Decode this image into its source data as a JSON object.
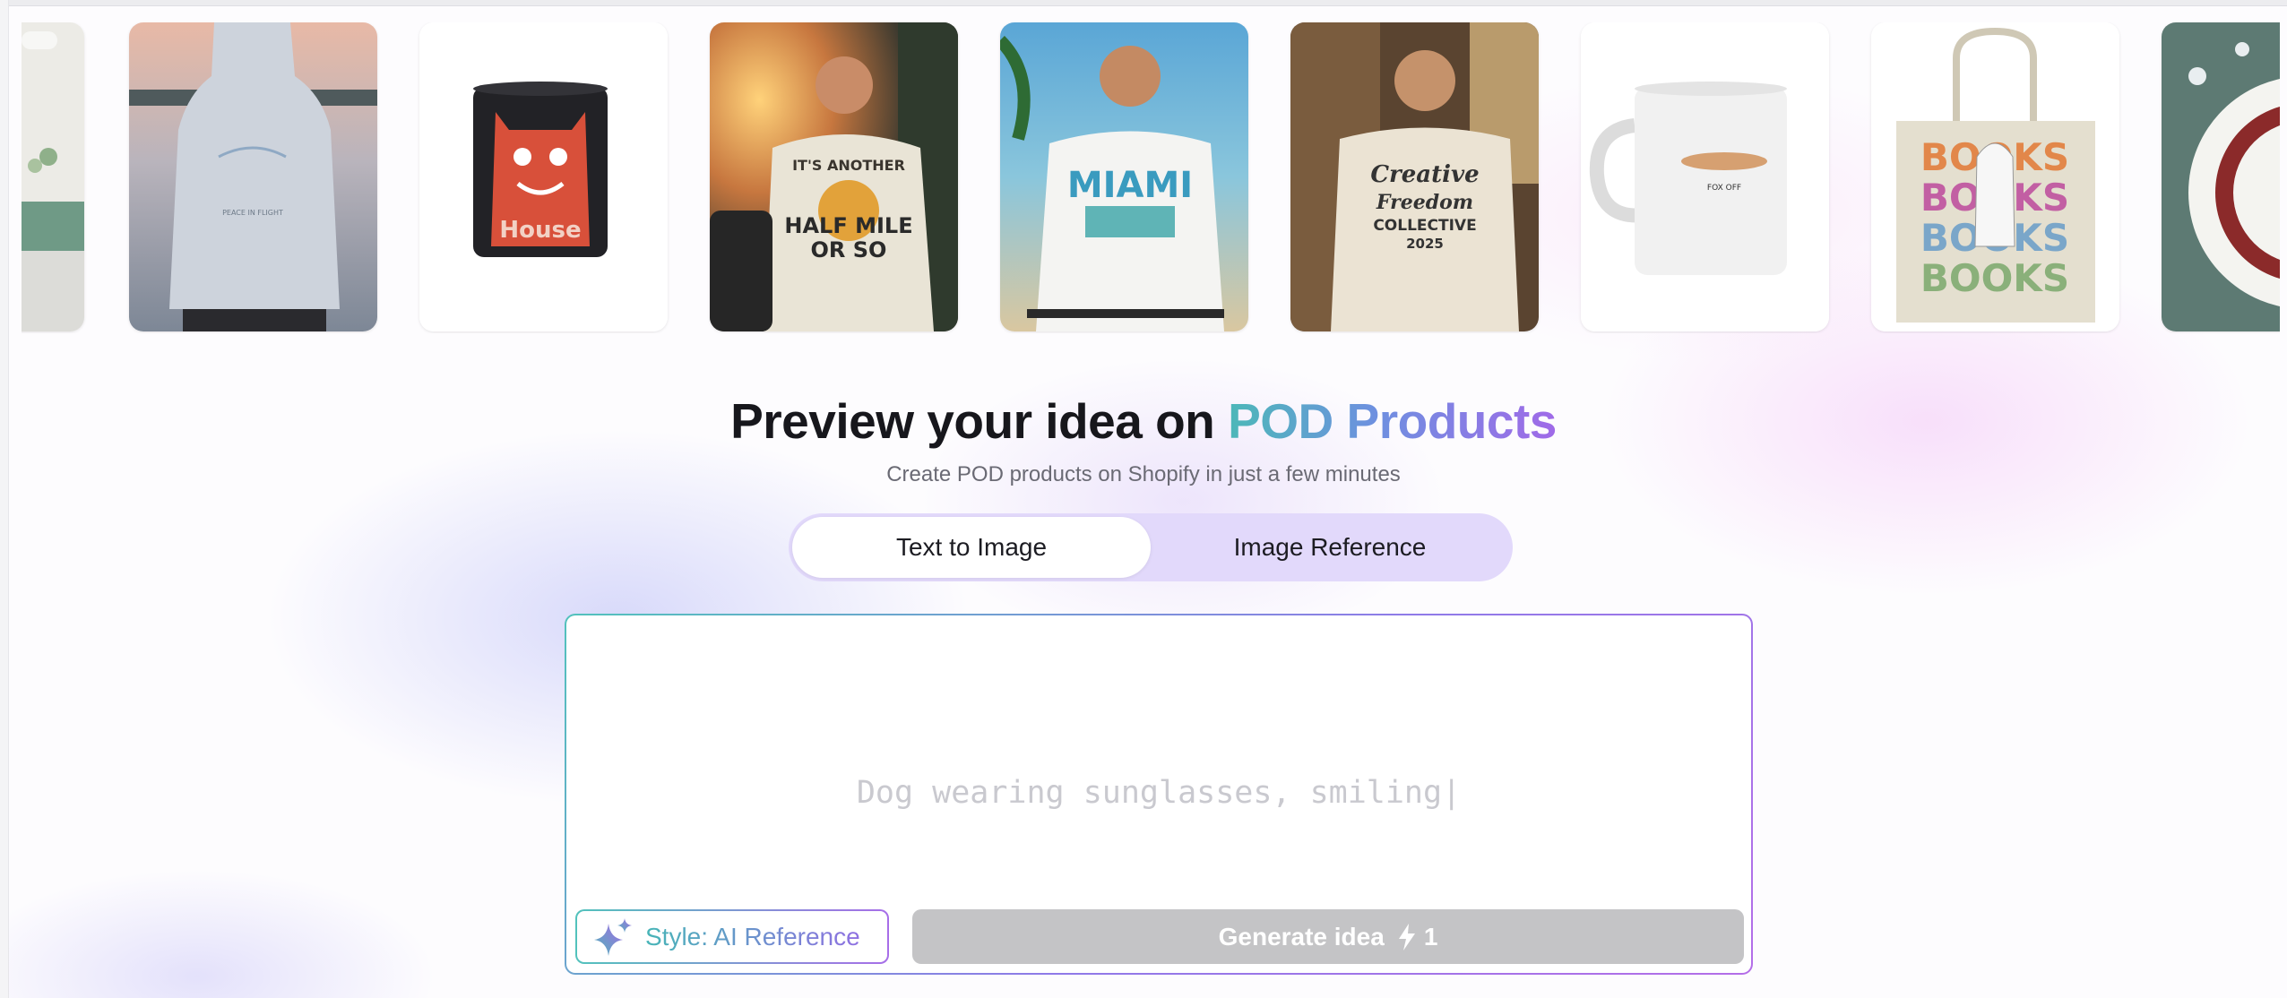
{
  "carousel": {
    "items": [
      {
        "name": "kitchen-scene",
        "icon": "kitchen-counter-image"
      },
      {
        "name": "hoodie-back",
        "print_text": "PEACE IN FLIGHT",
        "icon": "hoodie-image"
      },
      {
        "name": "black-mug",
        "print_text": "House",
        "icon": "mug-image"
      },
      {
        "name": "man-drinking-tshirt",
        "print_text": [
          "IT'S ANOTHER",
          "HALF MILE",
          "OR SO"
        ],
        "icon": "tshirt-image"
      },
      {
        "name": "miami-tshirt",
        "print_text": "MIAMI",
        "icon": "tshirt-image"
      },
      {
        "name": "creative-freedom-tshirt",
        "print_text": [
          "Creative",
          "Freedom",
          "COLLECTIVE",
          "2025"
        ],
        "icon": "tshirt-image"
      },
      {
        "name": "white-mug",
        "print_text": "FOX OFF",
        "icon": "mug-image"
      },
      {
        "name": "books-tote",
        "print_text": [
          "BOOKS",
          "BOOKS",
          "BOOKS",
          "BOOKS"
        ],
        "icon": "tote-bag-image"
      },
      {
        "name": "christmas-plate",
        "icon": "plate-image"
      }
    ]
  },
  "hero": {
    "title_prefix": "Preview your idea on ",
    "title_highlight": "POD Products",
    "subtitle": "Create POD products on Shopify in just a few minutes"
  },
  "tabs": [
    {
      "label": "Text to Image",
      "active": true
    },
    {
      "label": "Image Reference",
      "active": false
    }
  ],
  "prompt": {
    "placeholder": "Dog wearing sunglasses, smiling|"
  },
  "actions": {
    "style_label": "Style: AI Reference",
    "generate_label": "Generate idea",
    "generate_cost": "1",
    "generate_icon": "lightning-bolt-icon",
    "style_icon": "sparkle-icon"
  },
  "colors": {
    "accent_teal": "#4cb8b8",
    "accent_purple": "#a06ae8",
    "tab_track": "#e2d9fb",
    "disabled_button": "#c4c4c6"
  }
}
